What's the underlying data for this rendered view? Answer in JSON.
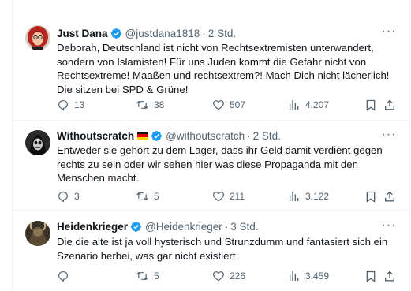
{
  "tweets": [
    {
      "name": "Just Dana",
      "handle": "@justdana1818",
      "dot": "·",
      "time": "2 Std.",
      "text": "Deborah, Deutschland ist nicht von Rechtsextremisten unterwandert, sondern von Islamisten! Für uns Juden kommt die Gefahr nicht von Rechtsextreme! Maaßen und rechtsextrem?! Mach Dich nicht lächerlich! Die sitzen bei SPD & Grüne!",
      "replies": "13",
      "reposts": "38",
      "likes": "507",
      "views": "4.207",
      "verified": true
    },
    {
      "name": "Withoutscratch",
      "flag": "german-flag",
      "handle": "@withoutscratch",
      "dot": "·",
      "time": "2 Std.",
      "text": "Entweder sie gehört zu dem Lager, dass ihr Geld damit verdient gegen rechts zu sein oder wir sehen hier was diese Propaganda mit den Menschen macht.",
      "replies": "3",
      "reposts": "5",
      "likes": "211",
      "views": "3.122",
      "verified": true
    },
    {
      "name": "Heidenkrieger",
      "handle": "@Heidenkrieger",
      "dot": "·",
      "time": "3 Std.",
      "text": "Die die alte ist ja voll hysterisch und Strunzdumm und fantasiert sich ein Szenario herbei, was gar nicht existiert",
      "replies": "",
      "reposts": "5",
      "likes": "226",
      "views": "3.459",
      "verified": true
    }
  ],
  "colors": {
    "verified": "#1d9bf0",
    "muted": "#536471",
    "text": "#0f1419",
    "border": "#eff3f4"
  },
  "icons": {
    "reply": "reply-icon",
    "repost": "repost-icon",
    "like": "heart-icon",
    "views": "views-icon",
    "bookmark": "bookmark-icon",
    "share": "share-icon",
    "more": "more-icon"
  }
}
